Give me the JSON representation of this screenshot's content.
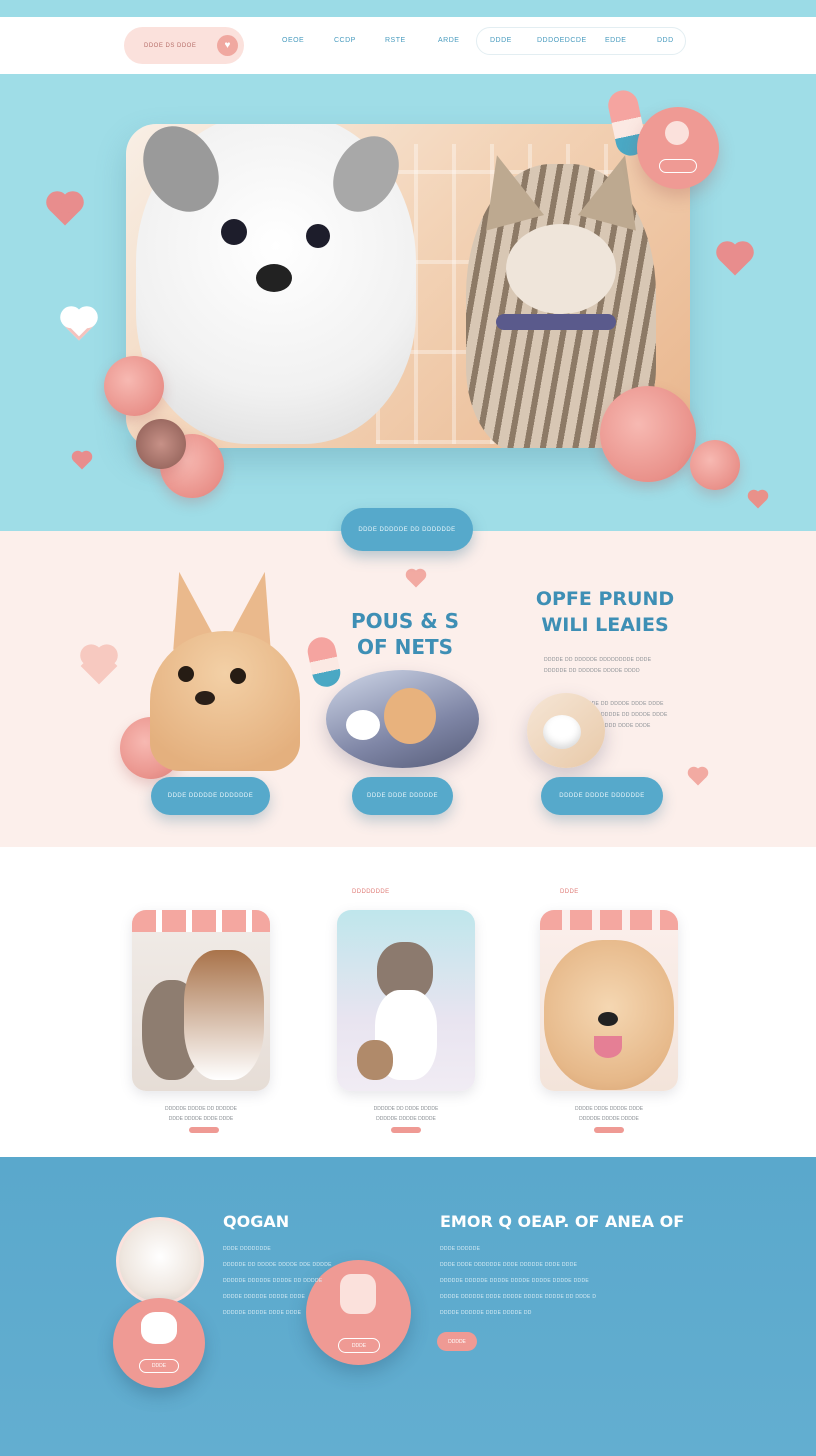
{
  "nav": {
    "logo_label": "DDOE DS DDOE",
    "links": [
      "OEOE",
      "CCDP",
      "RSTE",
      "ARDE"
    ],
    "pill_links": [
      "DDDE",
      "DDDOEDCDE",
      "EDDE",
      "DDD"
    ]
  },
  "hero": {
    "cta_label": "DDDE DDDDDE DD DDDDDDE"
  },
  "section2": {
    "title_a": [
      "POUS & S",
      "OF NETS"
    ],
    "title_b": [
      "OPFE PRUND",
      "WILI LEAIES"
    ],
    "para_b": [
      "DDDDE DD DDDDDE DDDDDDDDE DDDE",
      "DDDDDE DD DDDDDE DDDDE DDDD"
    ],
    "para_c": [
      "DDDDDE DD DDDDE DDDE DDDE",
      "DDDDE DDDDDE DD DDDDE DDDE",
      "DDDDDE DDDD DDDE DDDE"
    ],
    "btn1_label": "DDDE DDDDDE DDDDDDE",
    "btn2_label": "DDDE DDDE DDDDDE",
    "btn3_label": "DDDDE DDDDE DDDDDDE"
  },
  "section3": {
    "label_mid": "DDDDDDDE",
    "label_right": "DDDE",
    "cards": [
      {
        "caption": [
          "DDDDDE DDDDE DD DDDDDE",
          "DDDE DDDDE DDDE DDDE"
        ]
      },
      {
        "caption": [
          "DDDDDE DD DDDE DDDDE",
          "DDDDDE DDDDE DDDDE"
        ]
      },
      {
        "caption": [
          "DDDDE DDDE DDDDE DDDE",
          "DDDDDE DDDDE DDDDE"
        ]
      }
    ]
  },
  "footer": {
    "title_left": "QOGAN",
    "subtitle_left": "DDDE DDDDDDDE",
    "lines_left": [
      "DDDDDE DD DDDDE DDDDE DDE DDDDE",
      "DDDDDE DDDDDE DDDDE DD DDDDE",
      "DDDDE DDDDDE DDDDE DDDE",
      "DDDDDE DDDDE DDDE DDDE"
    ],
    "title_right": "EMOR Q OEAP. OF ANEA OF",
    "subtitle_right": "DDDE DDDDDE",
    "lines_right": [
      "DDDE DDDE DDDDDDE DDDE DDDDDE DDDE DDDE",
      "DDDDDE DDDDDE DDDDE DDDDE DDDDE DDDDE DDDE",
      "DDDDE DDDDDE DDDE DDDDE DDDDE DDDDE DD DDDE D",
      "DDDDE DDDDDE DDDE DDDDE DD"
    ],
    "cta_label": "DDDDE",
    "badge1_label": "DDDE",
    "badge2_label": "DDDE"
  },
  "colors": {
    "sky": "#9fdde7",
    "blue": "#56a9cb",
    "pink": "#ef9a94",
    "blush": "#fcefeb"
  }
}
